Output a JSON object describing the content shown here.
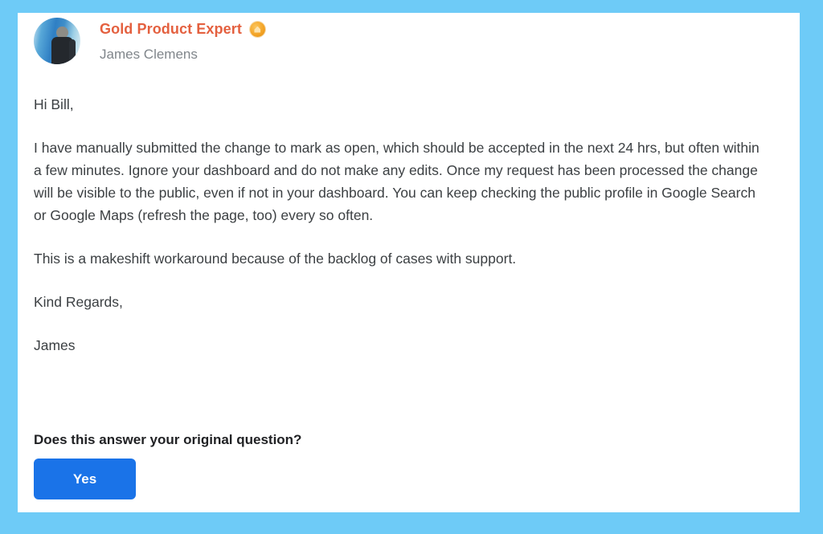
{
  "theme": {
    "frame_color": "#6ECBF7",
    "card_background": "#FFFFFF",
    "expert_title_color": "#E4603F",
    "badge_color": "#F3A325",
    "author_name_color": "#80868B",
    "body_text_color": "#3C4043",
    "button_color": "#1A73E8",
    "button_text_color": "#FFFFFF"
  },
  "clipped_top_text": "",
  "author": {
    "expert_title": "Gold Product Expert",
    "badge_icon": "gold-badge-icon",
    "name": "James Clemens",
    "avatar_icon": "user-avatar-photo"
  },
  "message": {
    "greeting": "Hi Bill,",
    "paragraphs": [
      "I have manually submitted the change to mark as open, which should be accepted in the next 24 hrs, but often within a few minutes. Ignore your dashboard and do not make any edits. Once my request has been processed the change will be visible to the public, even if not in your dashboard. You can keep checking the public profile in Google Search or Google Maps (refresh the page, too) every so often.",
      "This is a makeshift workaround because of the backlog of cases with support."
    ],
    "closing": "Kind Regards,",
    "signature": "James"
  },
  "feedback": {
    "question": "Does this answer your original question?",
    "yes_label": "Yes"
  }
}
